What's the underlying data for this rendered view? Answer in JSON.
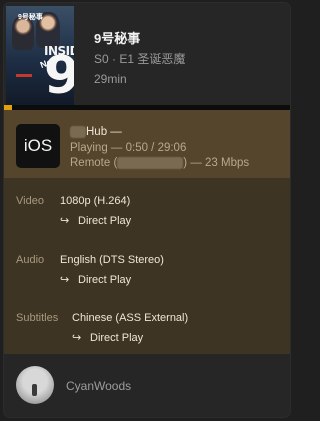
{
  "media": {
    "title": "9号秘事",
    "episode": "S0 · E1 圣诞恶魔",
    "runtime": "29min",
    "poster_text_inside": "INSIDE",
    "poster_text_nine": "9",
    "poster_text_no": "No.",
    "poster_text_cn": "9号秘事",
    "progress_fraction": 0.029
  },
  "player": {
    "icon_text": "iOS",
    "name_suffix": "Hub  —",
    "status": "Playing — 0:50 / 29:06",
    "remote_prefix": "Remote (",
    "remote_suffix": ") — 23 Mbps"
  },
  "streams": {
    "video": {
      "label": "Video",
      "value": "1080p (H.264)",
      "arrow": "↪",
      "decision": "Direct Play"
    },
    "audio": {
      "label": "Audio",
      "value": "English (DTS Stereo)",
      "arrow": "↪",
      "decision": "Direct Play"
    },
    "subtitles": {
      "label": "Subtitles",
      "value": "Chinese (ASS External)",
      "arrow": "↪",
      "decision": "Direct Play"
    }
  },
  "user": {
    "name": "CyanWoods"
  },
  "colors": {
    "accent": "#e5a00d",
    "player_bg": "#54452c",
    "streams_bg": "#3e3424",
    "card_bg": "#242424"
  }
}
